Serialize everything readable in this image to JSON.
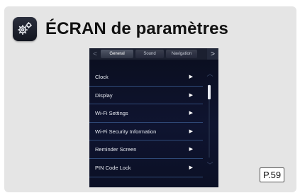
{
  "header": {
    "icon": "gear-icon",
    "title": "ÉCRAN de paramètres"
  },
  "screen": {
    "tabs": {
      "back": "<",
      "items": [
        {
          "label": "General",
          "active": true
        },
        {
          "label": "Sound",
          "active": false
        },
        {
          "label": "Navigation",
          "active": false
        }
      ],
      "next": ">"
    },
    "menu": [
      {
        "label": "Clock",
        "arrow": "▶"
      },
      {
        "label": "Display",
        "arrow": "▶"
      },
      {
        "label": "Wi-Fi Settings",
        "arrow": "▶"
      },
      {
        "label": "Wi-Fi Security Information",
        "arrow": "▶"
      },
      {
        "label": "Reminder Screen",
        "arrow": "▶"
      },
      {
        "label": "PIN Code Lock",
        "arrow": "▶"
      }
    ],
    "scroll": {
      "up": "︿",
      "down": "﹀"
    }
  },
  "page_ref": "P.59",
  "colors": {
    "card_bg": "#e5e5e5",
    "screen_bg": "#0f1430",
    "divider": "#2f4a78"
  }
}
